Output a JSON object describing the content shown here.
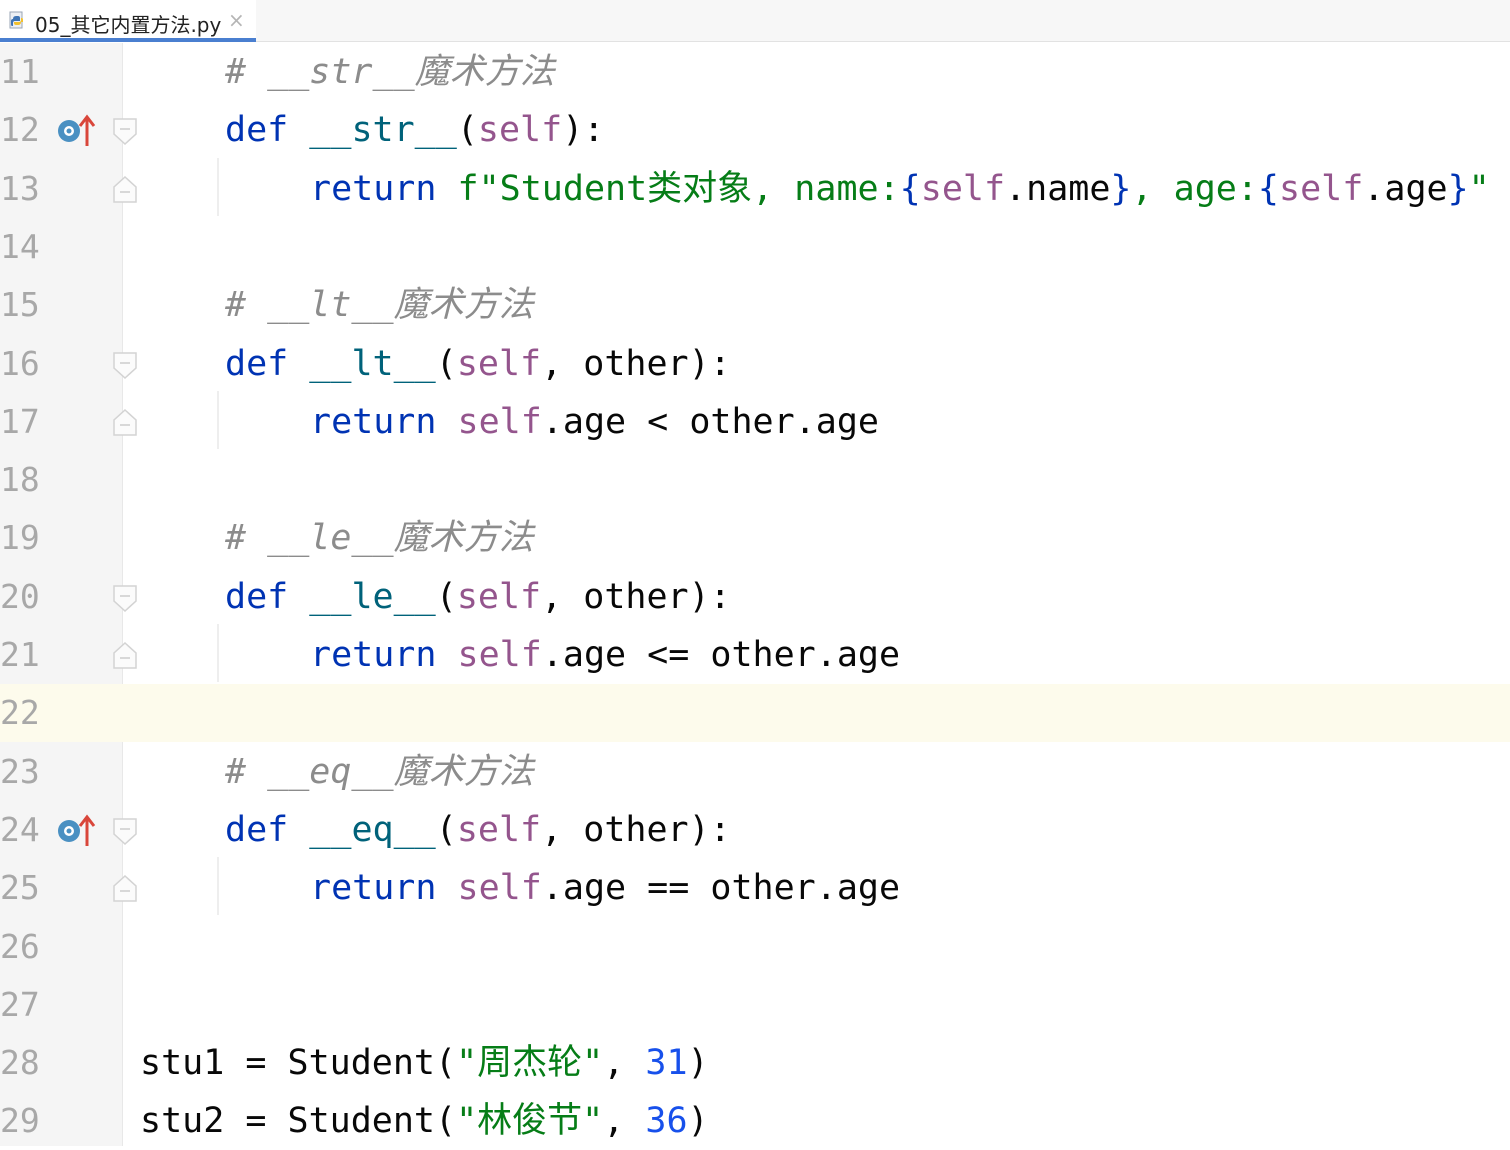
{
  "tab": {
    "title": "05_其它内置方法.py",
    "close": "×"
  },
  "editor": {
    "current_line": 22,
    "lines": [
      {
        "n": "11",
        "code": [
          {
            "t": "# __str__魔术方法",
            "c": "cmt"
          }
        ]
      },
      {
        "n": "12",
        "code": [
          {
            "t": "def ",
            "c": "kw"
          },
          {
            "t": "__str__",
            "c": "fn"
          },
          {
            "t": "(",
            "c": "plain"
          },
          {
            "t": "self",
            "c": "self"
          },
          {
            "t": "):",
            "c": "plain"
          }
        ]
      },
      {
        "n": "13",
        "code": [
          {
            "t": "return ",
            "c": "kw"
          },
          {
            "t": "f\"Student类对象, name:",
            "c": "str"
          },
          {
            "t": "{",
            "c": "kw"
          },
          {
            "t": "self",
            "c": "self"
          },
          {
            "t": ".name",
            "c": "plain"
          },
          {
            "t": "}",
            "c": "kw"
          },
          {
            "t": ", age:",
            "c": "str"
          },
          {
            "t": "{",
            "c": "kw"
          },
          {
            "t": "self",
            "c": "self"
          },
          {
            "t": ".age",
            "c": "plain"
          },
          {
            "t": "}",
            "c": "kw"
          },
          {
            "t": "\"",
            "c": "str"
          }
        ]
      },
      {
        "n": "14",
        "code": []
      },
      {
        "n": "15",
        "code": [
          {
            "t": "# __lt__魔术方法",
            "c": "cmt"
          }
        ]
      },
      {
        "n": "16",
        "code": [
          {
            "t": "def ",
            "c": "kw"
          },
          {
            "t": "__lt__",
            "c": "fn"
          },
          {
            "t": "(",
            "c": "plain"
          },
          {
            "t": "self",
            "c": "self"
          },
          {
            "t": ", other):",
            "c": "plain"
          }
        ]
      },
      {
        "n": "17",
        "code": [
          {
            "t": "return ",
            "c": "kw"
          },
          {
            "t": "self",
            "c": "self"
          },
          {
            "t": ".age < other.age",
            "c": "plain"
          }
        ]
      },
      {
        "n": "18",
        "code": []
      },
      {
        "n": "19",
        "code": [
          {
            "t": "# __le__魔术方法",
            "c": "cmt"
          }
        ]
      },
      {
        "n": "20",
        "code": [
          {
            "t": "def ",
            "c": "kw"
          },
          {
            "t": "__le__",
            "c": "fn"
          },
          {
            "t": "(",
            "c": "plain"
          },
          {
            "t": "self",
            "c": "self"
          },
          {
            "t": ", other):",
            "c": "plain"
          }
        ]
      },
      {
        "n": "21",
        "code": [
          {
            "t": "return ",
            "c": "kw"
          },
          {
            "t": "self",
            "c": "self"
          },
          {
            "t": ".age <= other.age",
            "c": "plain"
          }
        ]
      },
      {
        "n": "22",
        "code": []
      },
      {
        "n": "23",
        "code": [
          {
            "t": "# __eq__魔术方法",
            "c": "cmt"
          }
        ]
      },
      {
        "n": "24",
        "code": [
          {
            "t": "def ",
            "c": "kw"
          },
          {
            "t": "__eq__",
            "c": "fn"
          },
          {
            "t": "(",
            "c": "plain"
          },
          {
            "t": "self",
            "c": "self"
          },
          {
            "t": ", other):",
            "c": "plain"
          }
        ]
      },
      {
        "n": "25",
        "code": [
          {
            "t": "return ",
            "c": "kw"
          },
          {
            "t": "self",
            "c": "self"
          },
          {
            "t": ".age == other.age",
            "c": "plain"
          }
        ]
      },
      {
        "n": "26",
        "code": []
      },
      {
        "n": "27",
        "code": []
      },
      {
        "n": "28",
        "code": [
          {
            "t": "stu1 = Student(",
            "c": "plain"
          },
          {
            "t": "\"周杰轮\"",
            "c": "str"
          },
          {
            "t": ", ",
            "c": "plain"
          },
          {
            "t": "31",
            "c": "num"
          },
          {
            "t": ")",
            "c": "plain"
          }
        ]
      },
      {
        "n": "29",
        "code": [
          {
            "t": "stu2 = Student(",
            "c": "plain"
          },
          {
            "t": "\"林俊节\"",
            "c": "str"
          },
          {
            "t": ", ",
            "c": "plain"
          },
          {
            "t": "36",
            "c": "num"
          },
          {
            "t": ")",
            "c": "plain"
          }
        ]
      }
    ]
  },
  "gutter_icons": {
    "12": "override-method-icon",
    "24": "override-method-icon"
  },
  "colors": {
    "keyword": "#0033b3",
    "string": "#067d17",
    "comment": "#8c8c8c",
    "self": "#94558d",
    "number": "#1750eb",
    "current_line": "#fdfbec"
  }
}
